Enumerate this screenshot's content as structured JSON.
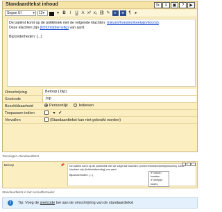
{
  "editor": {
    "title": "Standaardtekst inhoud",
    "window_buttons": [
      "fx",
      "≡",
      "▣",
      "?",
      "▶"
    ],
    "toolbar": {
      "font": "Segoe UI",
      "size": "12",
      "tools": [
        "B",
        "I",
        "U",
        "A",
        "x²",
        "x₂",
        "≡",
        "≣",
        "¶"
      ]
    },
    "body": {
      "line1_prefix": "De patiënt komt op de polikliniek met de volgende klachten: ",
      "line1_var": "{niezen/hoesten/keelpijn/koorts}",
      "line1_suffix": ".",
      "line2_prefix": "Deze klachten zijn ",
      "line2_var": "{licht/mild/ernstig}",
      "line2_suffix": " van aard.",
      "line3": "Bijzonderheden: {...}"
    }
  },
  "properties": {
    "omschrijving_label": "Omschrijving",
    "omschrijving_value": "Beloop (.blp)",
    "snelcode_label": "Snelcode",
    "snelcode_value": ".blp",
    "beschikbaarheid_label": "Beschikbaarheid",
    "option_personal": "Persoonlijk",
    "option_everyone": "Iedereen",
    "toepassen_label": "Toepassen indien",
    "vervallen_label": "Vervallen",
    "vervallen_note": "(Standaardtekst kan niet gebruikt worden)"
  },
  "caption_top": "Toevoegen standaardtekst",
  "consult": {
    "left_label": "Beloop",
    "line1": "De patiënt komt op de polikliniek met de volgende klachten: {niezen/hoesten/keelpijn/koorts}. Deze",
    "line2": "klachten zijn {licht/mild/ernstig} van aard.",
    "line3": "Bijzonderheden: {...}",
    "options": [
      "✔ niezen",
      "hoesten",
      "✔ keelpijn",
      "koorts"
    ]
  },
  "caption_bottom": "Standaardtekst in het consultformulier",
  "tip": {
    "prefix": "Tip: Voeg de ",
    "underlined": "snelcode",
    "suffix": " toe aan de omschrijving van de standaardtekst"
  },
  "colors": {
    "panel": "#fbefc2",
    "tip_background": "#e4f0fb",
    "link": "#1d4fd0",
    "tip_icon": "#2275c7"
  }
}
